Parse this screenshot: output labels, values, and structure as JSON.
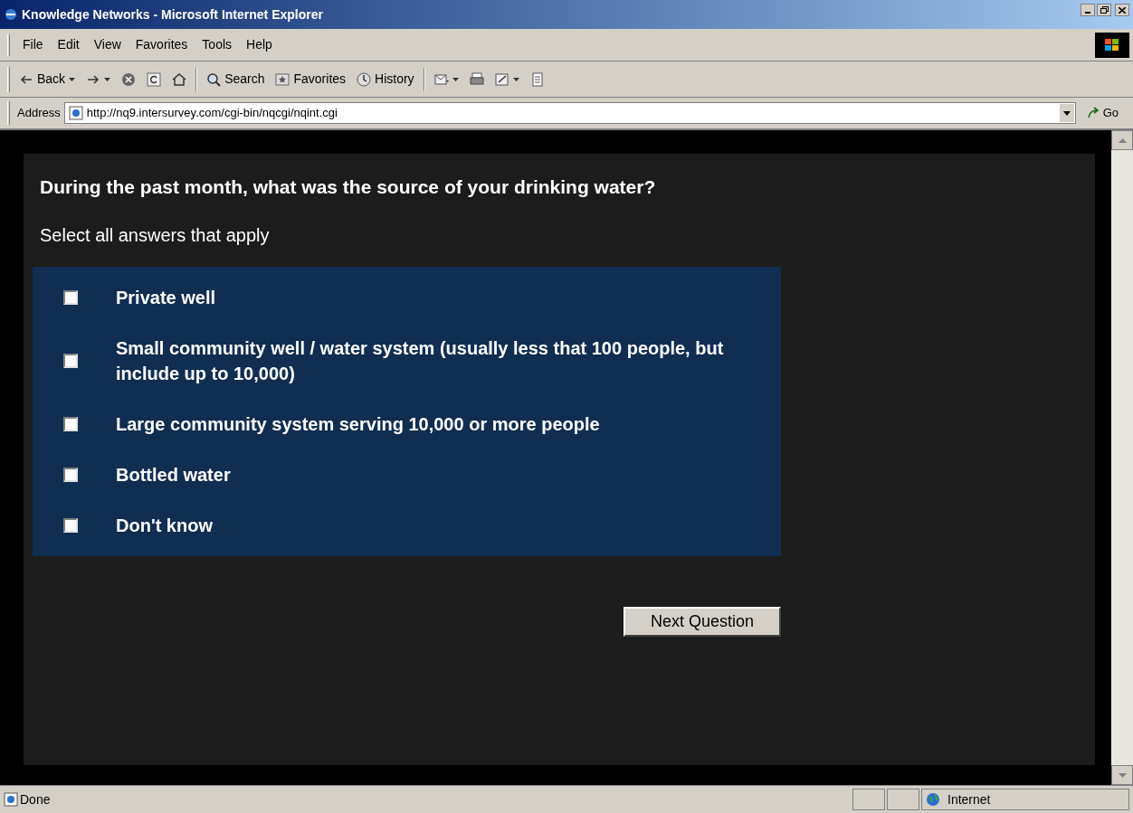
{
  "window": {
    "title": "Knowledge Networks - Microsoft Internet Explorer"
  },
  "menu": [
    "File",
    "Edit",
    "View",
    "Favorites",
    "Tools",
    "Help"
  ],
  "toolbar": [
    {
      "kind": "back",
      "label": "Back"
    },
    {
      "kind": "forward"
    },
    {
      "kind": "stop"
    },
    {
      "kind": "refresh"
    },
    {
      "kind": "home"
    },
    {
      "kind": "search",
      "label": "Search"
    },
    {
      "kind": "favorites",
      "label": "Favorites"
    },
    {
      "kind": "history",
      "label": "History"
    },
    {
      "kind": "mail"
    },
    {
      "kind": "print"
    },
    {
      "kind": "edit"
    },
    {
      "kind": "discuss"
    }
  ],
  "address": {
    "label": "Address",
    "value": "http://nq9.intersurvey.com/cgi-bin/nqcgi/nqint.cgi",
    "go": "Go"
  },
  "question": {
    "title": "During the past month, what was the source of your drinking water?",
    "instruction": "Select all answers that apply",
    "options": [
      {
        "label": "Private well",
        "checked": false
      },
      {
        "label": "Small community well / water system (usually less that 100 people, but include up to 10,000)",
        "checked": false
      },
      {
        "label": "Large community system serving 10,000 or more people",
        "checked": false
      },
      {
        "label": "Bottled water",
        "checked": false
      },
      {
        "label": "Don't know",
        "checked": false
      }
    ],
    "next_button": "Next Question"
  },
  "status_bar": {
    "text": "Done",
    "zone": "Internet"
  }
}
